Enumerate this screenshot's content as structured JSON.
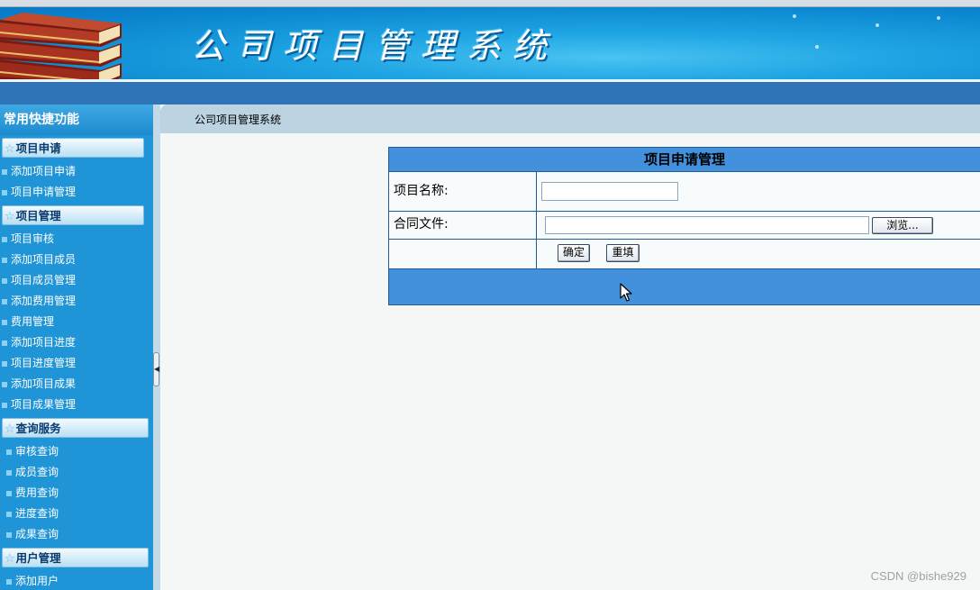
{
  "app": {
    "title": "公司项目管理系统"
  },
  "breadcrumb": "公司项目管理系统",
  "sidebar": {
    "title": "常用快捷功能",
    "groups": [
      {
        "title": "项目申请",
        "items": [
          "添加项目申请",
          "项目申请管理"
        ]
      },
      {
        "title": "项目管理",
        "items": [
          "项目审核",
          "添加项目成员",
          "项目成员管理",
          "添加费用管理",
          "费用管理",
          "添加项目进度",
          "项目进度管理",
          "添加项目成果",
          "项目成果管理"
        ]
      },
      {
        "title": "查询服务",
        "items": [
          "审核查询",
          "成员查询",
          "费用查询",
          "进度查询",
          "成果查询"
        ]
      },
      {
        "title": "用户管理",
        "items": [
          "添加用户"
        ]
      }
    ]
  },
  "form": {
    "title": "项目申请管理",
    "name_label": "项目名称:",
    "name_value": "",
    "file_label": "合同文件:",
    "file_value": "",
    "browse_label": "浏览...",
    "submit_label": "确定",
    "reset_label": "重填"
  },
  "watermark": "CSDN @bishe929",
  "colors": {
    "header": "#1ea4e3",
    "sidebar": "#1f94d6",
    "panel_header": "#4391dc",
    "navbar": "#2f74b8"
  },
  "icons": {
    "group": "star-icon",
    "item": "square-bullet-icon",
    "collapse": "triangle-left-icon",
    "cursor": "mouse-pointer-icon"
  }
}
